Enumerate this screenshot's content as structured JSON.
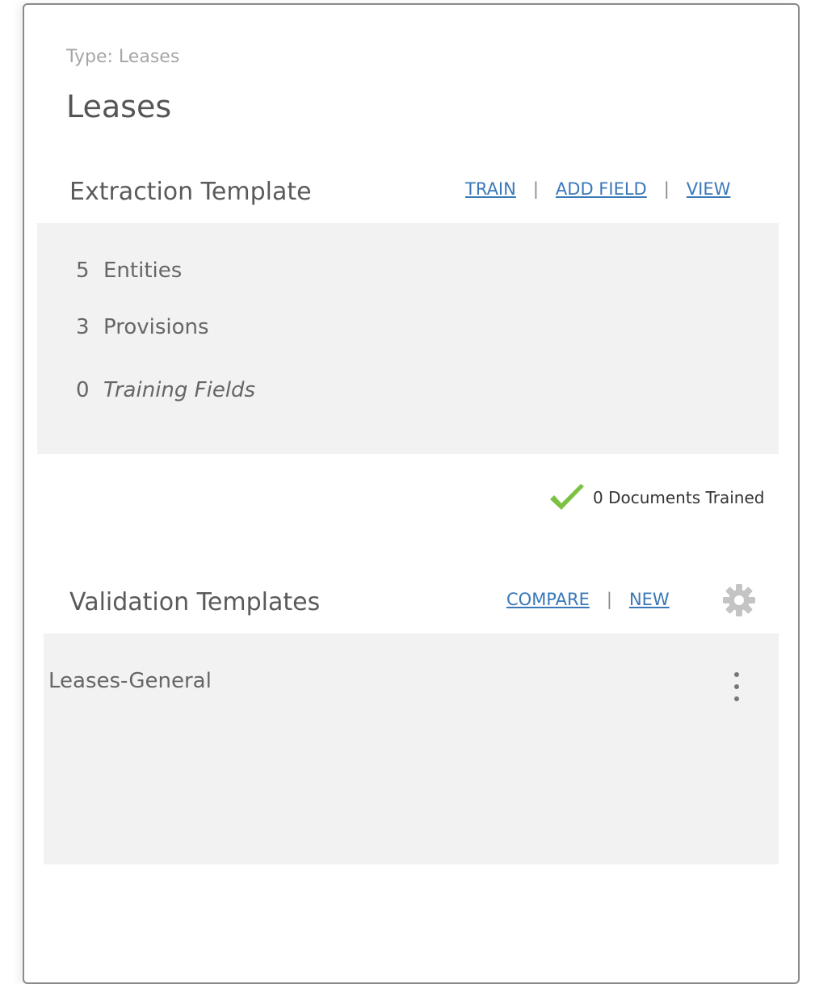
{
  "card": {
    "type_label": "Type: Leases",
    "title": "Leases"
  },
  "extraction": {
    "title": "Extraction Template",
    "links": {
      "train": "TRAIN",
      "add_field": "ADD FIELD",
      "view": "VIEW",
      "separator": "|"
    },
    "stats": [
      {
        "count": "5",
        "label": "Entities"
      },
      {
        "count": "3",
        "label": "Provisions"
      },
      {
        "count": "0",
        "label": "Training Fields"
      }
    ],
    "trained_status": "0 Documents Trained",
    "status_icon": "check-icon",
    "status_color": "#7cc142"
  },
  "validation": {
    "title": "Validation Templates",
    "links": {
      "compare": "COMPARE",
      "new": "NEW",
      "separator": "|"
    },
    "settings_icon": "gear-icon",
    "items": [
      {
        "label": "Leases-General",
        "menu_icon": "kebab-icon"
      }
    ]
  },
  "colors": {
    "link": "#3a78b8",
    "panel_bg": "#f2f2f2",
    "border": "#8a8a8a"
  }
}
